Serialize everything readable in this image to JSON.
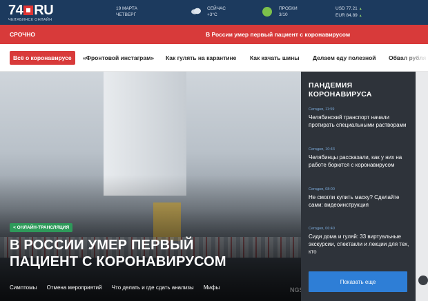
{
  "header": {
    "logo_number": "74",
    "logo_suffix": "RU",
    "logo_sub": "ЧЕЛЯБИНСК ОНЛАЙН",
    "date_line1": "19 МАРТА",
    "date_line2": "ЧЕТВЕРГ",
    "weather_label": "СЕЙЧАС",
    "weather_temp": "+3°C",
    "traffic_label": "ПРОБКИ",
    "traffic_value": "3/10",
    "usd": "USD 77.21",
    "eur": "EUR 84.89",
    "rate_trend_symbol": "▲"
  },
  "breaking": {
    "label": "СРОЧНО",
    "text": "В России умер первый пациент с коронавирусом"
  },
  "nav": {
    "items": [
      "Всё о коронавирусе",
      "«Фронтовой инстаграм»",
      "Как гулять на карантине",
      "Как качать шины",
      "Делаем еду полезной",
      "Обвал рубля"
    ]
  },
  "hero": {
    "badge": "< ОНЛАЙН-ТРАНСЛЯЦИЯ",
    "title_line1": "В РОССИИ УМЕР ПЕРВЫЙ",
    "title_line2": "ПАЦИЕНТ С КОРОНАВИРУСОМ",
    "links": [
      "Симптомы",
      "Отмена мероприятий",
      "Что делать и где сдать анализы",
      "Мифы"
    ],
    "watermark": "NGS"
  },
  "sidebar": {
    "title_line1": "ПАНДЕМИЯ",
    "title_line2": "КОРОНАВИРУСА",
    "news": [
      {
        "time": "Сегодня, 11:59",
        "text": "Челябинский транспорт начали протирать специальными растворами"
      },
      {
        "time": "Сегодня, 10:43",
        "text": "Челябинцы рассказали, как у них на работе борются с коронавирусом"
      },
      {
        "time": "Сегодня, 08:00",
        "text": "Не смогли купить маску? Сделайте сами: видеоинструкция"
      },
      {
        "time": "Сегодня, 06:40",
        "text": "Сиди дома и гуляй: 33 виртуальные экскурсии, спектакли и лекции для тех, кто"
      }
    ],
    "show_more": "Показать еще"
  },
  "colors": {
    "header_bg": "#1c3a5e",
    "breaking_bg": "#d83a3a",
    "sidebar_bg": "#2e333a",
    "accent_blue": "#2e7ed6",
    "badge_green": "#2e9a5a"
  }
}
